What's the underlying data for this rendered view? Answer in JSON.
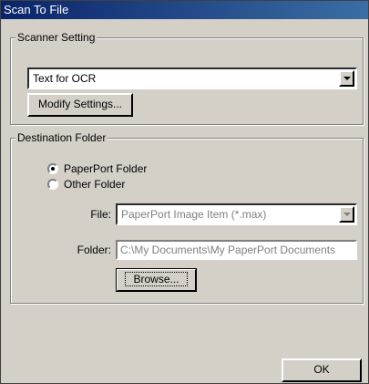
{
  "window": {
    "title": "Scan To File"
  },
  "scanner_setting": {
    "legend": "Scanner Setting",
    "selected_option": "Text for OCR",
    "modify_button": "Modify Settings..."
  },
  "destination": {
    "legend": "Destination Folder",
    "radio_paperport": "PaperPort Folder",
    "radio_other": "Other Folder",
    "selected_radio": "PaperPort Folder",
    "file_label": "File:",
    "file_value": "PaperPort Image Item (*.max)",
    "folder_label": "Folder:",
    "folder_value": "C:\\My Documents\\My PaperPort Documents",
    "browse_button": "Browse..."
  },
  "ok_button": "OK"
}
